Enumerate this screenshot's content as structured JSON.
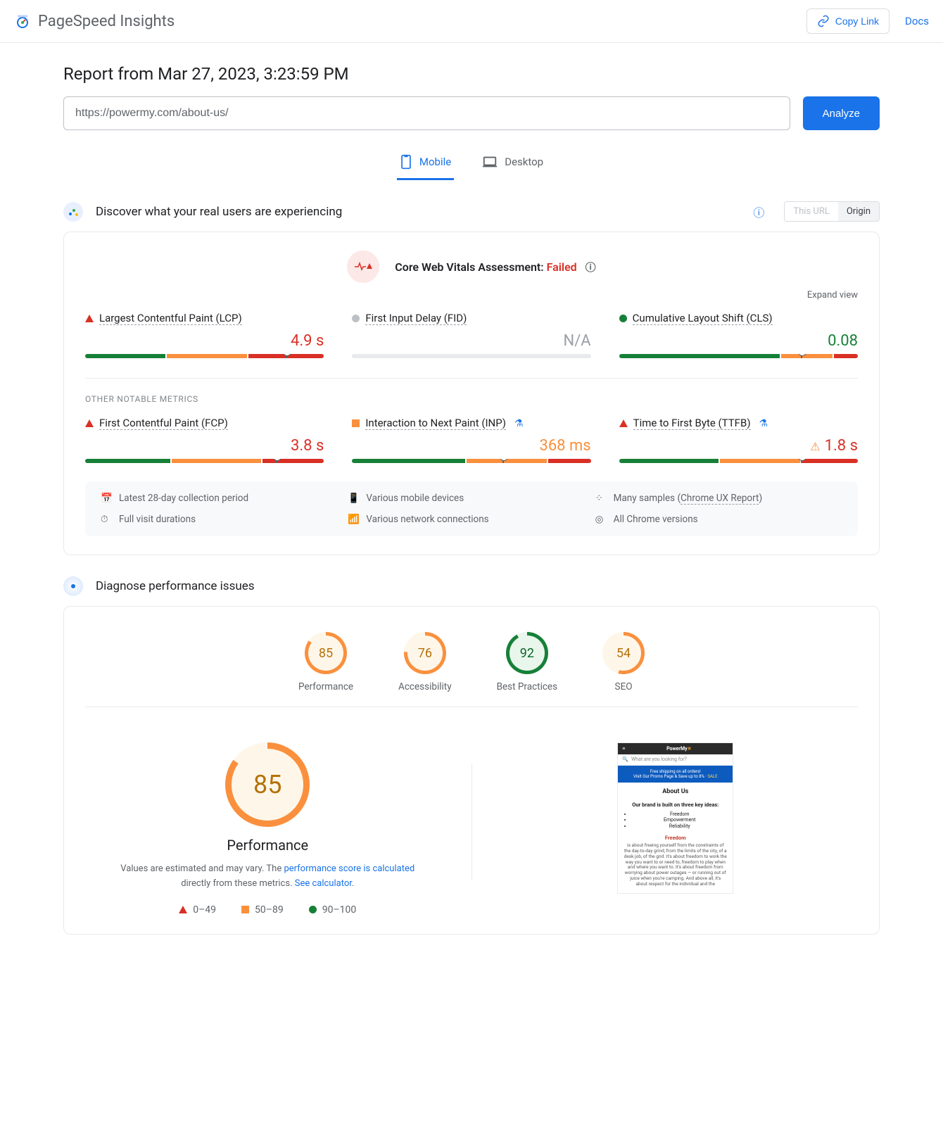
{
  "header": {
    "title": "PageSpeed Insights",
    "copy_link": "Copy Link",
    "docs": "Docs"
  },
  "report": {
    "heading_prefix": "Report from ",
    "timestamp": "Mar 27, 2023, 3:23:59 PM",
    "url_value": "https://powermy.com/about-us/",
    "analyze_label": "Analyze"
  },
  "tabs": {
    "mobile": "Mobile",
    "desktop": "Desktop"
  },
  "crux": {
    "section_title": "Discover what your real users are experiencing",
    "toggle_this": "This URL",
    "toggle_origin": "Origin",
    "assessment_label": "Core Web Vitals Assessment: ",
    "assessment_status": "Failed",
    "expand": "Expand view",
    "metrics_primary": [
      {
        "name": "Largest Contentful Paint (LCP)",
        "value": "4.9 s",
        "shape": "tri-red",
        "val_class": "red",
        "seg": [
          34,
          34,
          32
        ],
        "marker": 84
      },
      {
        "name": "First Input Delay (FID)",
        "value": "N/A",
        "shape": "circ-gy",
        "val_class": "gry",
        "seg_gray": true
      },
      {
        "name": "Cumulative Layout Shift (CLS)",
        "value": "0.08",
        "shape": "circ-gn",
        "val_class": "grn",
        "seg": [
          68,
          22,
          10
        ],
        "marker": 76
      }
    ],
    "other_label": "OTHER NOTABLE METRICS",
    "metrics_other": [
      {
        "name": "First Contentful Paint (FCP)",
        "value": "3.8 s",
        "shape": "tri-red",
        "val_class": "red",
        "seg": [
          36,
          38,
          26
        ],
        "marker": 80
      },
      {
        "name": "Interaction to Next Paint (INP)",
        "value": "368 ms",
        "shape": "sq-or",
        "val_class": "ora",
        "flask": true,
        "seg": [
          48,
          34,
          18
        ],
        "marker": 63
      },
      {
        "name": "Time to First Byte (TTFB)",
        "value": "1.8 s",
        "shape": "tri-red",
        "val_class": "red",
        "warn": true,
        "flask": true,
        "seg": [
          42,
          34,
          24
        ],
        "marker": 76
      }
    ],
    "meta": {
      "period": "Latest 28-day collection period",
      "devices": "Various mobile devices",
      "samples_prefix": "Many samples (",
      "samples_link": "Chrome UX Report",
      "samples_suffix": ")",
      "durations": "Full visit durations",
      "networks": "Various network connections",
      "versions": "All Chrome versions"
    }
  },
  "lab": {
    "section_title": "Diagnose performance issues",
    "gauges": [
      {
        "label": "Performance",
        "score": "85",
        "pct": 85,
        "color": "#fa903e",
        "bg": "#fef7e9",
        "txt": "#b5720a"
      },
      {
        "label": "Accessibility",
        "score": "76",
        "pct": 76,
        "color": "#fa903e",
        "bg": "#fef7e9",
        "txt": "#b5720a"
      },
      {
        "label": "Best Practices",
        "score": "92",
        "pct": 92,
        "color": "#178038",
        "bg": "#e9f6ec",
        "txt": "#0d652d"
      },
      {
        "label": "SEO",
        "score": "54",
        "pct": 54,
        "color": "#fa903e",
        "bg": "#fef7e9",
        "txt": "#b5720a"
      }
    ],
    "big_score": "85",
    "big_pct": 85,
    "perf_title": "Performance",
    "desc_1": "Values are estimated and may vary. The ",
    "desc_link1": "performance score is calculated",
    "desc_2": " directly from these metrics. ",
    "desc_link2": "See calculator",
    "desc_3": ".",
    "legend": {
      "bad": "0–49",
      "mid": "50–89",
      "good": "90–100"
    }
  },
  "screenshot": {
    "brand": "PowerMy",
    "search_placeholder": "What are you looking for?",
    "banner1": "Free shipping on all orders!",
    "banner2": "Visit Our Promo Page & Save up to 8%",
    "banner_tag": "SALE",
    "h1": "About Us",
    "p1": "Our brand is built on three key ideas:",
    "li1": "Freedom",
    "li2": "Empowerment",
    "li3": "Reliability",
    "h2": "Freedom",
    "body": "is about freeing yourself from the constraints of the day-to-day grind, from the limits of the city, of a desk job, of the grid. It's about freedom to work the way you want to or need to, freedom to play when and where you want to. It's about freedom from worrying about power outages — or running out of juice when you're camping. And above all, it's about respect for the individual and the"
  }
}
